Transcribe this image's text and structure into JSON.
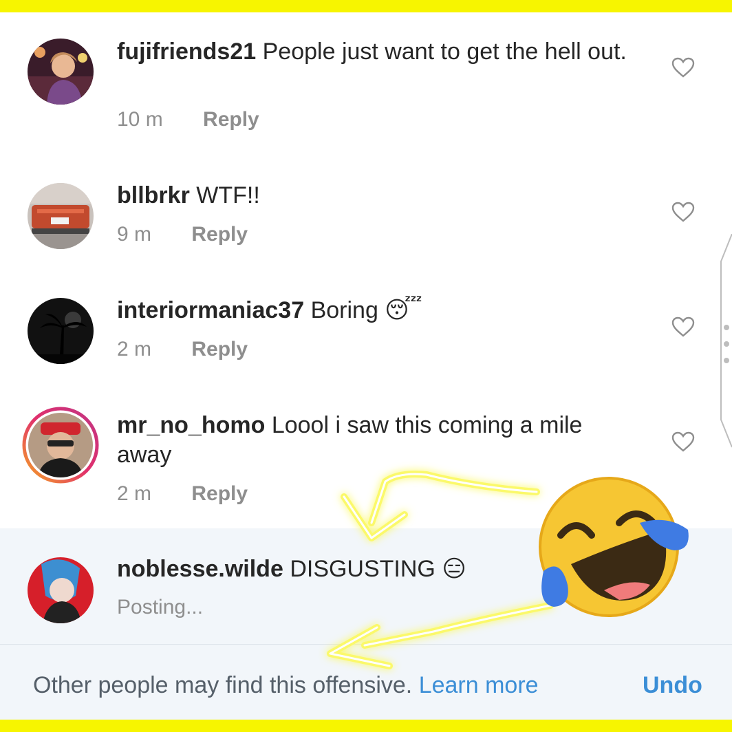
{
  "comments": [
    {
      "username": "fujifriends21",
      "text": "People just want to get the hell out.",
      "time": "10 m",
      "reply": "Reply",
      "avatar": "avatar-photo-woman"
    },
    {
      "username": "bllbrkr",
      "text": "WTF!!",
      "time": "9 m",
      "reply": "Reply",
      "avatar": "avatar-photo-car"
    },
    {
      "username": "interiormaniac37",
      "text": "Boring 😴",
      "time": "2 m",
      "reply": "Reply",
      "avatar": "avatar-photo-palm"
    },
    {
      "username": "mr_no_homo",
      "text": "Loool i saw this coming a mile away",
      "time": "2 m",
      "reply": "Reply",
      "avatar": "avatar-photo-man-story-ring"
    }
  ],
  "pending": {
    "username": "noblesse.wilde",
    "text": "DISGUSTING 😑",
    "status": "Posting..."
  },
  "warning": {
    "message": "Other people may find this offensive.",
    "link": "Learn more",
    "undo": "Undo"
  },
  "icons": {
    "like": "heart-outline-icon",
    "annotation": "laughing-tears-emoji"
  },
  "colors": {
    "border_yellow": "#f7f500",
    "link_blue": "#3b8ed6",
    "pending_bg": "#f2f6fa",
    "story_ring": "#e1306c"
  }
}
